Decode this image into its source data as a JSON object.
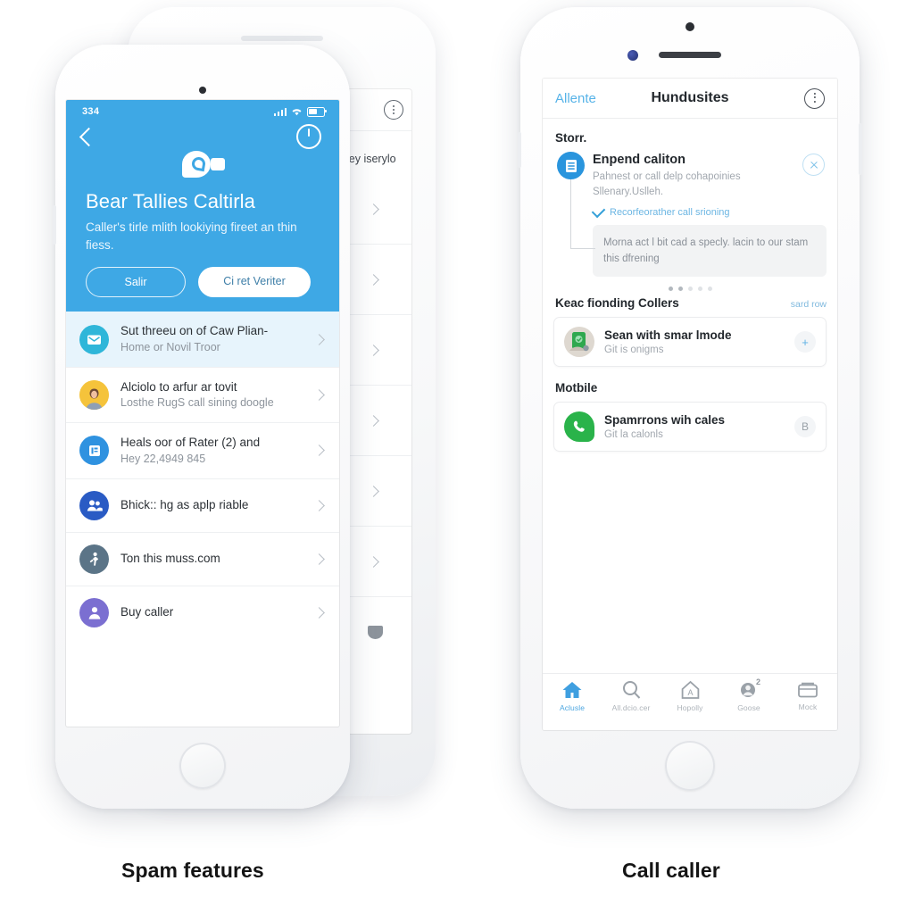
{
  "captions": {
    "left": "Spam features",
    "right": "Call caller"
  },
  "left_phone": {
    "status_bar": {
      "time": "334",
      "signal_icon": "cellular-bars-icon",
      "wifi_icon": "wifi-icon",
      "battery_icon": "battery-icon"
    },
    "hero": {
      "back_icon": "back-chevron-icon",
      "power_icon": "power-icon",
      "logo_icon": "chat-bubble-logo-icon",
      "title": "Bear Tallies Caltirla",
      "subtitle": "Caller's tirle mlith lookiying fireet an thin fiess.",
      "button_outline": "Salir",
      "button_solid": "Ci ret Veriter"
    },
    "list": [
      {
        "icon": "mail-envelope-icon",
        "icon_color": "#2fb6d9",
        "title": "Sut threeu on of Caw Plian-",
        "subtitle": "Home or Novil Troor",
        "highlighted": true,
        "chevron_icon": "chevron-right-icon"
      },
      {
        "icon": "person-photo-avatar-icon",
        "icon_color": "#f5c33b",
        "title": "Alciolo to arfur ar tovit",
        "subtitle": "Losthe RugS call sining doogle",
        "highlighted": false,
        "chevron_icon": "chevron-right-icon"
      },
      {
        "icon": "document-icon",
        "icon_color": "#2f92e0",
        "title": "Heals oor of Rater (2) and",
        "subtitle": "Hey 22,4949 845",
        "highlighted": false,
        "chevron_icon": "chevron-right-icon"
      },
      {
        "icon": "people-group-icon",
        "icon_color": "#2a5bc4",
        "title": "Bhick:: hg as aplp riable",
        "subtitle": "",
        "highlighted": false,
        "chevron_icon": "chevron-right-icon"
      },
      {
        "icon": "runner-icon",
        "icon_color": "#5b7487",
        "title": "Ton this muss.com",
        "subtitle": "",
        "highlighted": false,
        "chevron_icon": "chevron-right-icon"
      },
      {
        "icon": "person-icon",
        "icon_color": "#7b6fd1",
        "title": "Buy caller",
        "subtitle": "",
        "highlighted": false,
        "chevron_icon": "chevron-right-icon"
      }
    ]
  },
  "back_phone": {
    "kebab_icon": "more-options-icon",
    "text": "ley iserylo",
    "chevron_icon": "chevron-right-icon",
    "shield_icon": "shield-icon",
    "row_count": 6
  },
  "right_phone": {
    "navbar": {
      "left_action": "Allente",
      "title": "Hundusites",
      "kebab_icon": "more-options-icon"
    },
    "section_start": "Storr.",
    "tip": {
      "icon": "list-document-icon",
      "close_icon": "close-circle-icon",
      "title": "Enpend caliton",
      "subtitle": "Pahnest or call delp cohapoinies Sllenary.Uslleh.",
      "check_icon": "check-icon",
      "check_label": "Recorfeorather call srioning",
      "bubble_text": "Morna act l bit cad a specly. lacin to our stam this dfrening"
    },
    "dots": {
      "count": 5,
      "active": 2
    },
    "section_recent": {
      "title": "Keac fionding Collers",
      "link": "sard row"
    },
    "recent_card": {
      "icon": "green-app-photo-icon",
      "title": "Sean with smar lmode",
      "subtitle": "Git is onigms",
      "action_icon": "plus-icon",
      "action_label": "+"
    },
    "section_mobile": {
      "title": "Motbile"
    },
    "mobile_card": {
      "icon": "whatsapp-phone-icon",
      "title": "Spamrrons wih cales",
      "subtitle": "Git la calonls",
      "action_label": "B"
    },
    "tabs": [
      {
        "icon": "home-icon",
        "label": "Aclusle",
        "active": true,
        "badge": ""
      },
      {
        "icon": "search-icon",
        "label": "All.dcio.cer",
        "active": false,
        "badge": ""
      },
      {
        "icon": "house-a-icon",
        "label": "Hopolly",
        "active": false,
        "badge": ""
      },
      {
        "icon": "contact-icon",
        "label": "Goose",
        "active": false,
        "badge": "2"
      },
      {
        "icon": "wallet-icon",
        "label": "Mock",
        "active": false,
        "badge": ""
      }
    ]
  },
  "colors": {
    "brand_blue": "#3ea8e5",
    "link_blue": "#57b3e8",
    "green": "#2ab34a",
    "highlight_row": "#e7f4fc"
  }
}
